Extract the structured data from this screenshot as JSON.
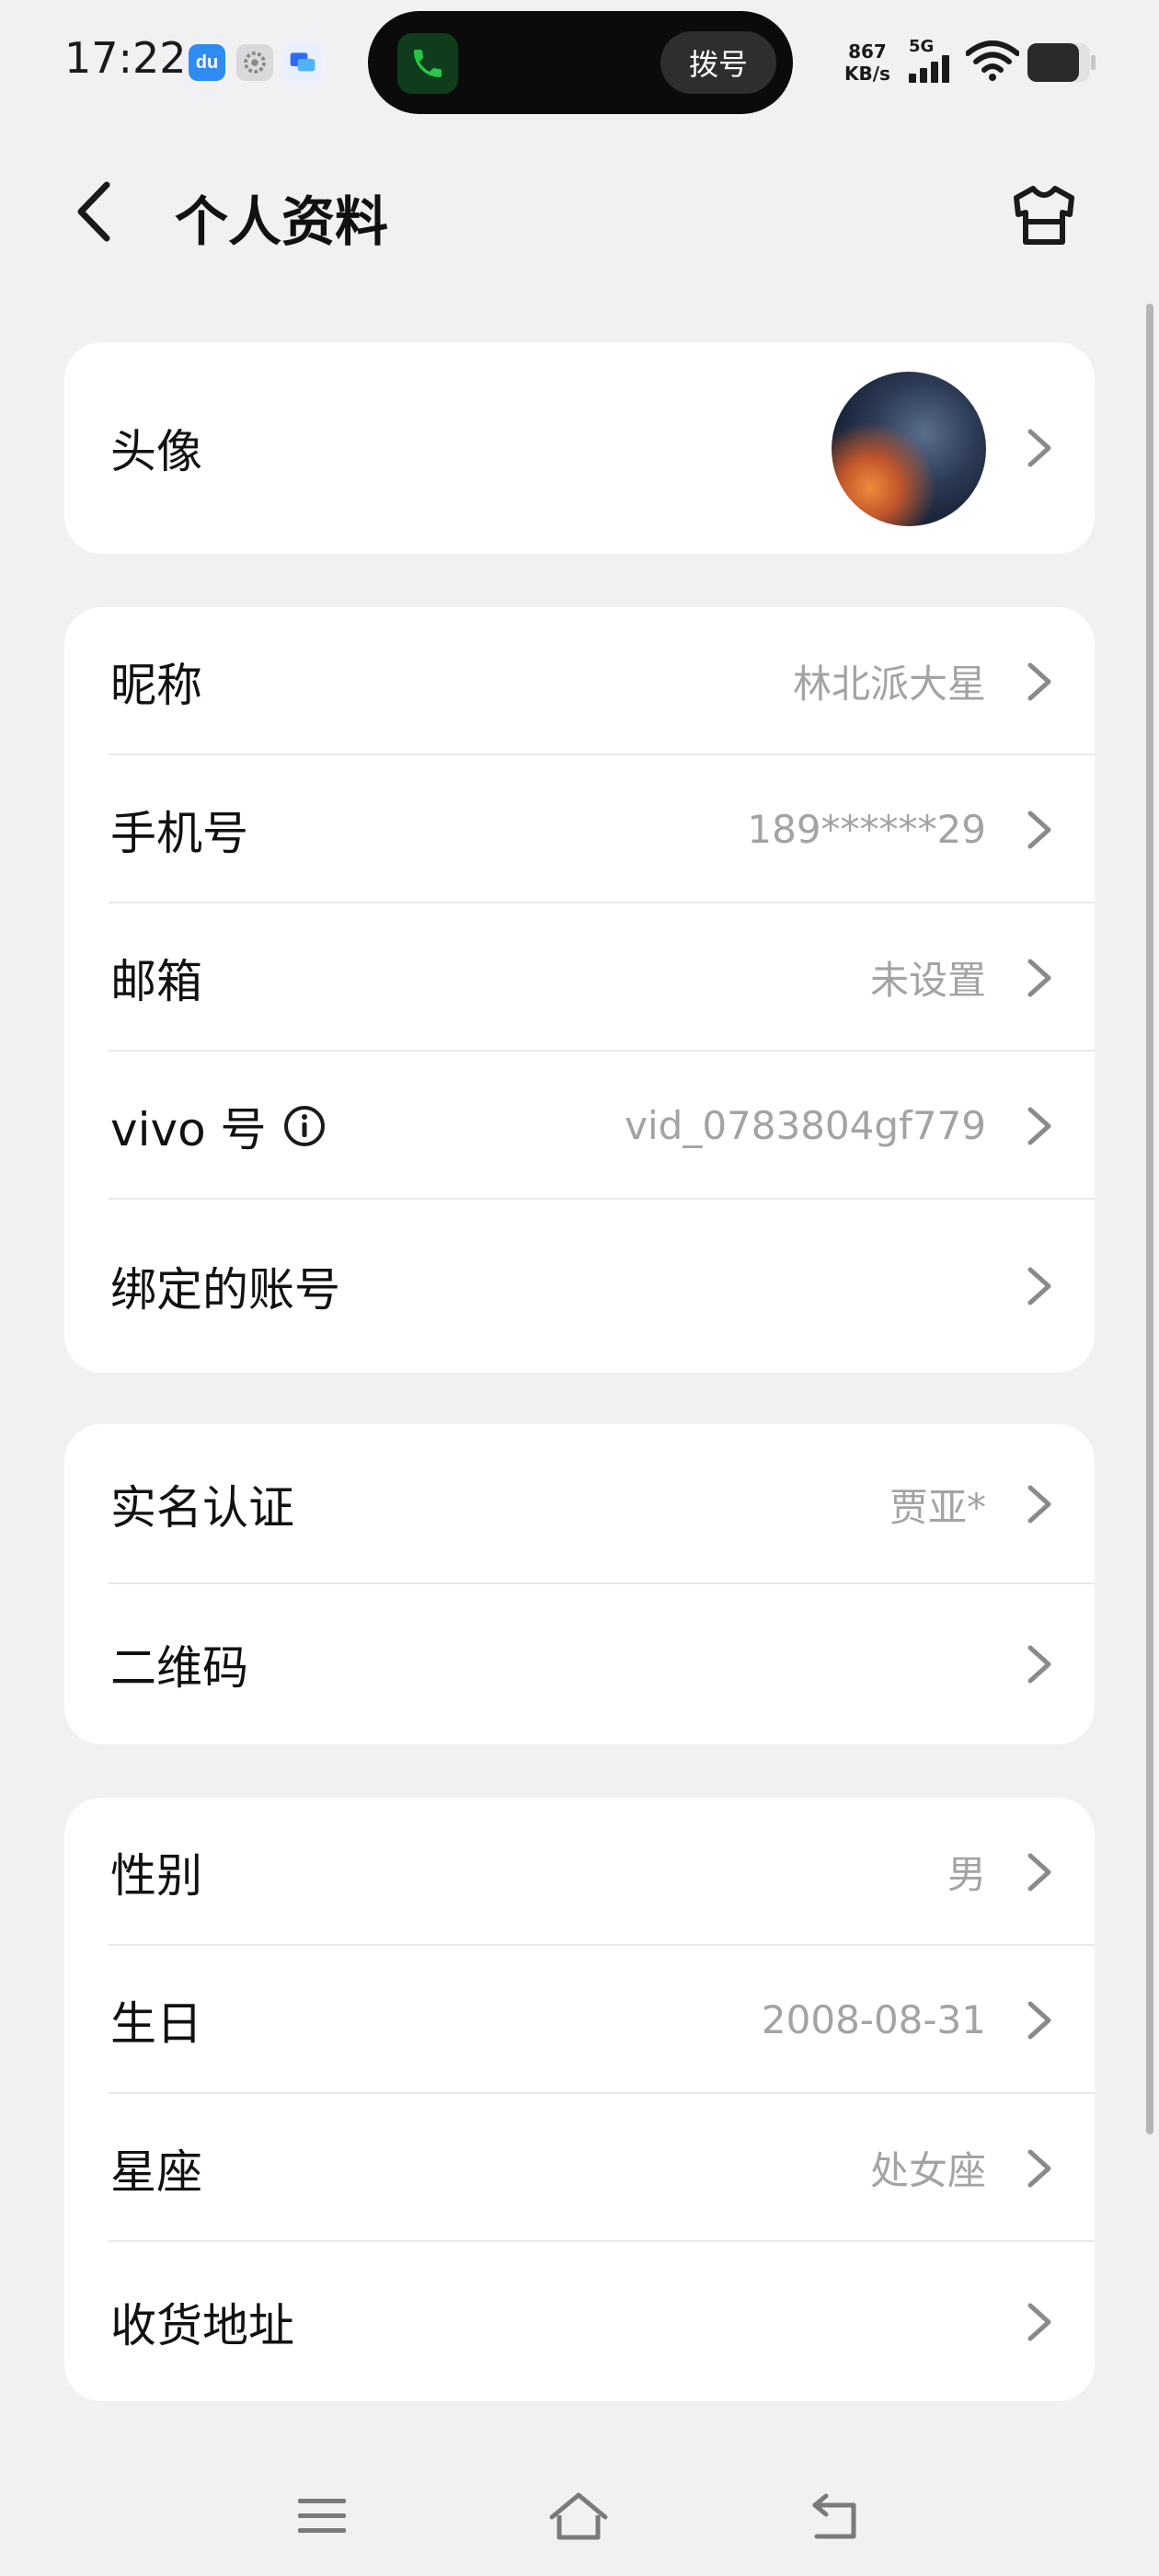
{
  "status_bar": {
    "time": "17:22",
    "notification_icons": [
      "du-app-icon",
      "settings-gear-icon",
      "chat-bubble-icon"
    ],
    "call_island": {
      "dial_label": "拨号"
    },
    "network_speed_value": "867",
    "network_speed_unit": "KB/s",
    "signal_label": "5G"
  },
  "header": {
    "title": "个人资料"
  },
  "profile": {
    "avatar_label": "头像",
    "account": [
      {
        "label": "昵称",
        "value": "林北派大星"
      },
      {
        "label": "手机号",
        "value": "189******29"
      },
      {
        "label": "邮箱",
        "value": "未设置"
      },
      {
        "label": "vivo 号",
        "value": "vid_0783804gf779"
      },
      {
        "label": "绑定的账号",
        "value": ""
      }
    ],
    "verification": [
      {
        "label": "实名认证",
        "value": "贾亚*"
      },
      {
        "label": "二维码",
        "value": ""
      }
    ],
    "personal": [
      {
        "label": "性别",
        "value": "男"
      },
      {
        "label": "生日",
        "value": "2008-08-31"
      },
      {
        "label": "星座",
        "value": "处女座"
      },
      {
        "label": "收货地址",
        "value": ""
      }
    ]
  },
  "colors": {
    "background": "#f1f1f3",
    "card": "#ffffff",
    "value_text": "#a3a3a3",
    "chevron": "#8a8a8a"
  }
}
